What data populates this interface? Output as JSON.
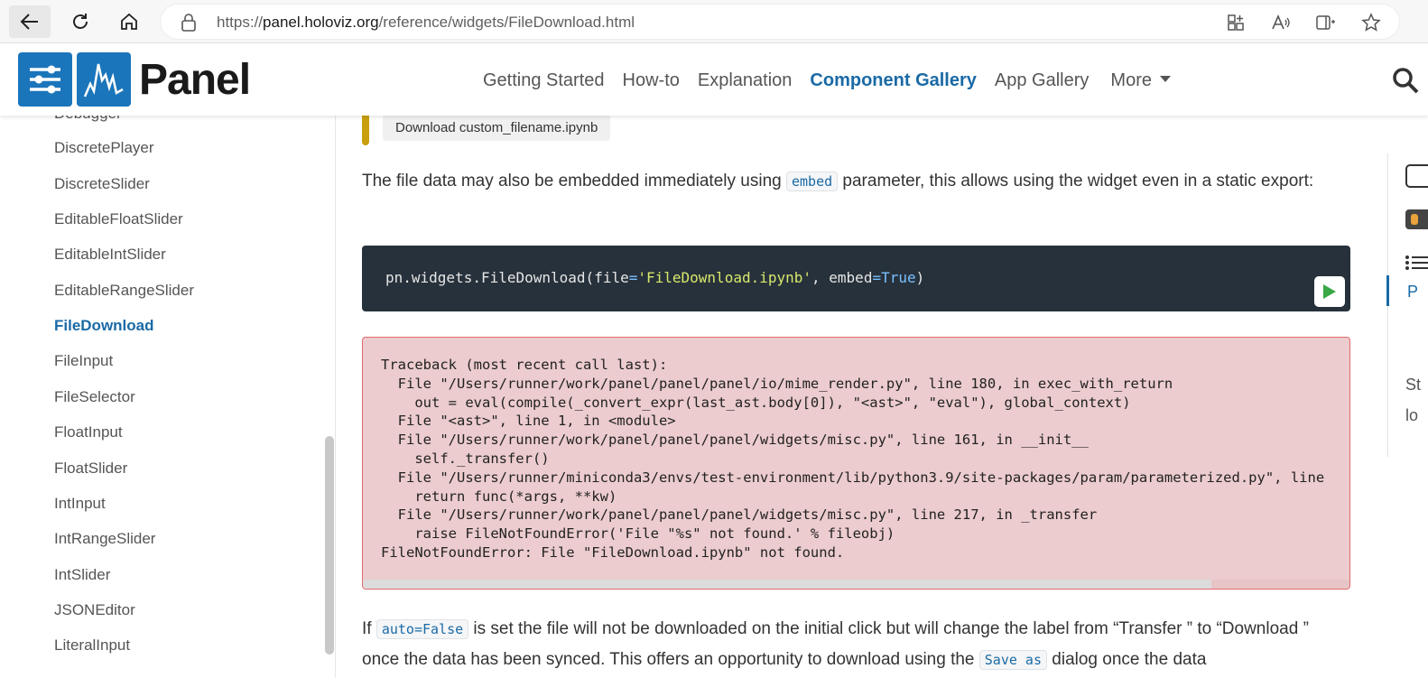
{
  "browser": {
    "url_prefix": "https://",
    "url_host": "panel.holoviz.org",
    "url_path": "/reference/widgets/FileDownload.html"
  },
  "header": {
    "logo_text": "Panel",
    "nav": [
      {
        "label": "Getting Started"
      },
      {
        "label": "How-to"
      },
      {
        "label": "Explanation"
      },
      {
        "label": "Component Gallery",
        "active": true
      },
      {
        "label": "App Gallery"
      }
    ],
    "more_label": "More"
  },
  "sidebar": {
    "items": [
      {
        "label": "Debugger"
      },
      {
        "label": "DiscretePlayer"
      },
      {
        "label": "DiscreteSlider"
      },
      {
        "label": "EditableFloatSlider"
      },
      {
        "label": "EditableIntSlider"
      },
      {
        "label": "EditableRangeSlider"
      },
      {
        "label": "FileDownload",
        "active": true
      },
      {
        "label": "FileInput"
      },
      {
        "label": "FileSelector"
      },
      {
        "label": "FloatInput"
      },
      {
        "label": "FloatSlider"
      },
      {
        "label": "IntInput"
      },
      {
        "label": "IntRangeSlider"
      },
      {
        "label": "IntSlider"
      },
      {
        "label": "JSONEditor"
      },
      {
        "label": "LiteralInput"
      }
    ]
  },
  "main": {
    "download_button": "Download custom_filename.ipynb",
    "para1": {
      "before": "The file data may also be embedded immediately using ",
      "code": "embed",
      "after": " parameter, this allows using the widget even in a static export:"
    },
    "code": {
      "prefix": "pn.widgets.FileDownload(",
      "arg1": "file",
      "eq": "=",
      "str": "'FileDownload.ipynb'",
      "sep": ", ",
      "arg2": "embed",
      "val": "True",
      "suffix": ")"
    },
    "traceback": "Traceback (most recent call last):\n  File \"/Users/runner/work/panel/panel/panel/io/mime_render.py\", line 180, in exec_with_return\n    out = eval(compile(_convert_expr(last_ast.body[0]), \"<ast>\", \"eval\"), global_context)\n  File \"<ast>\", line 1, in <module>\n  File \"/Users/runner/work/panel/panel/panel/widgets/misc.py\", line 161, in __init__\n    self._transfer()\n  File \"/Users/runner/miniconda3/envs/test-environment/lib/python3.9/site-packages/param/parameterized.py\", line\n    return func(*args, **kw)\n  File \"/Users/runner/work/panel/panel/panel/widgets/misc.py\", line 217, in _transfer\n    raise FileNotFoundError('File \"%s\" not found.' % fileobj)\nFileNotFoundError: File \"FileDownload.ipynb\" not found.",
    "para2": {
      "t1": "If ",
      "code1": "auto=False",
      "t2": " is set the file will not be downloaded on the initial click but will change the label from “Transfer ” to “Download ” once the data has been synced. This offers an opportunity to download using the ",
      "code2": "Save as",
      "t3": " dialog once the data"
    }
  },
  "toc": {
    "fragments": [
      "P",
      "St",
      "lo"
    ]
  }
}
